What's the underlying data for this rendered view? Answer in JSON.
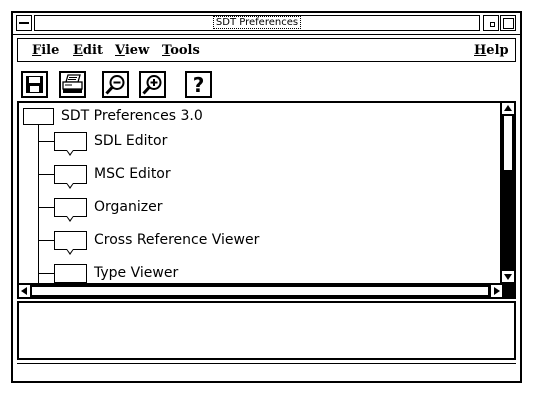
{
  "window": {
    "title": "SDT Preferences"
  },
  "menu": {
    "file": {
      "first": "F",
      "rest": "ile"
    },
    "edit": {
      "first": "E",
      "rest": "dit"
    },
    "view": {
      "first": "V",
      "rest": "iew"
    },
    "tools": {
      "first": "T",
      "rest": "ools"
    },
    "help": {
      "first": "H",
      "rest": "elp"
    }
  },
  "toolbar": {
    "buttons": [
      "save-icon",
      "print-icon",
      "zoom-out-icon",
      "zoom-in-icon",
      "help-icon"
    ],
    "help_glyph": "?"
  },
  "tree": {
    "root": "SDT Preferences 3.0",
    "items": [
      "SDL Editor",
      "MSC Editor",
      "Organizer",
      "Cross Reference Viewer",
      "Type Viewer"
    ]
  }
}
